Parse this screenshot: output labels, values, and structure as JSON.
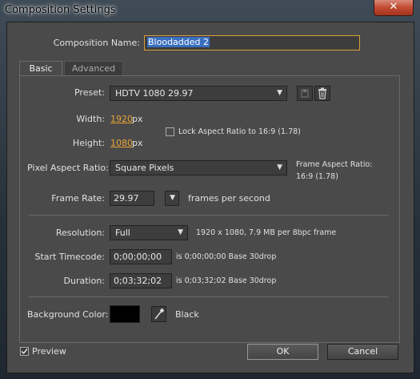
{
  "window": {
    "title": "Composition Settings",
    "close_glyph": "✕"
  },
  "comp_name": {
    "label": "Composition Name:",
    "value": "Bloodadded 2"
  },
  "tabs": [
    {
      "label": "Basic"
    },
    {
      "label": "Advanced"
    }
  ],
  "preset": {
    "label": "Preset:",
    "value": "HDTV 1080 29.97"
  },
  "width": {
    "label": "Width:",
    "value": "1920",
    "unit": "px"
  },
  "height": {
    "label": "Height:",
    "value": "1080",
    "unit": "px"
  },
  "lock_aspect": {
    "label": "Lock Aspect Ratio to 16:9 (1.78)",
    "checked": false
  },
  "par": {
    "label": "Pixel Aspect Ratio:",
    "value": "Square Pixels"
  },
  "frame_aspect": {
    "label": "Frame Aspect Ratio:",
    "value": "16:9 (1.78)"
  },
  "frame_rate": {
    "label": "Frame Rate:",
    "value": "29.97",
    "unit": "frames per second"
  },
  "resolution": {
    "label": "Resolution:",
    "value": "Full",
    "info": "1920 x 1080, 7.9 MB per 8bpc frame"
  },
  "start_timecode": {
    "label": "Start Timecode:",
    "value": "0;00;00;00",
    "info": "is 0;00;00;00  Base 30drop"
  },
  "duration": {
    "label": "Duration:",
    "value": "0;03;32;02",
    "info": "is 0;03;32;02  Base 30drop"
  },
  "background": {
    "label": "Background Color:",
    "swatch": "#000000",
    "name": "Black"
  },
  "preview": {
    "label": "Preview",
    "checked": true
  },
  "buttons": {
    "ok": "OK",
    "cancel": "Cancel"
  },
  "colors": {
    "dialog_bg": "#4a4a4a",
    "link": "#e8a338",
    "focus_border": "#d9a13a",
    "selection": "#3a6fc0"
  }
}
